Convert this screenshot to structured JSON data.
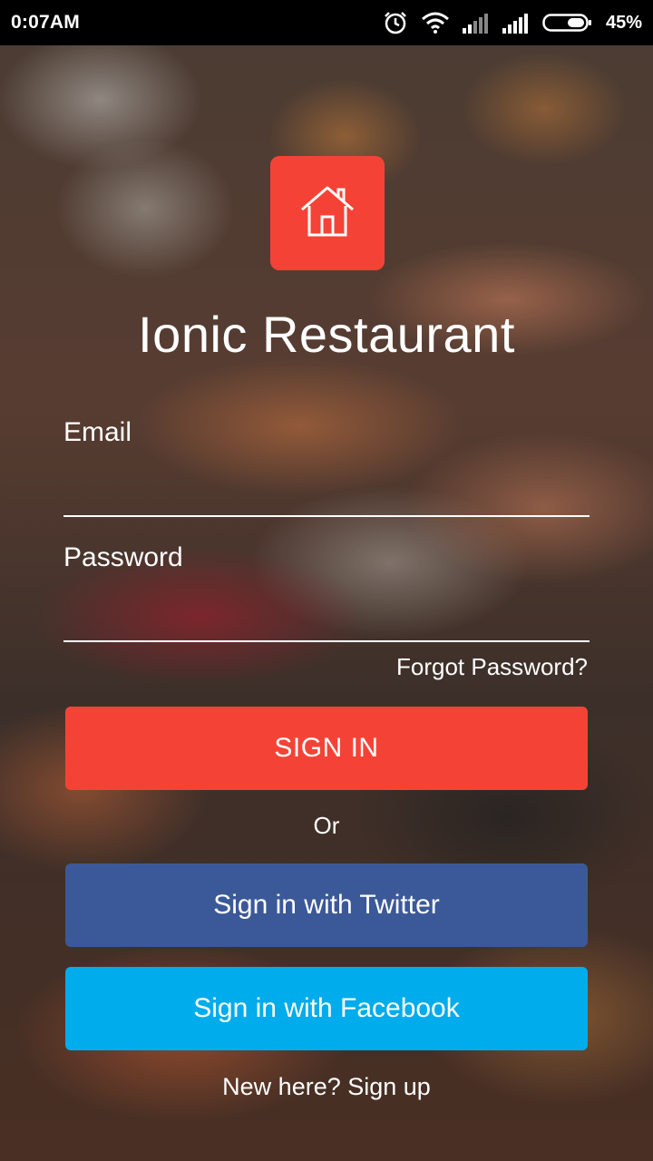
{
  "status_bar": {
    "time": "0:07AM",
    "battery_percent": "45%",
    "icons": [
      "alarm-icon",
      "wifi-icon",
      "signal-icon",
      "signal-icon",
      "battery-icon"
    ]
  },
  "app": {
    "title": "Ionic Restaurant",
    "logo_icon": "home-icon",
    "accent_color": "#f44336"
  },
  "login_form": {
    "email_label": "Email",
    "email_value": "",
    "password_label": "Password",
    "password_value": "",
    "forgot_password": "Forgot Password?",
    "sign_in_label": "SIGN IN",
    "or_label": "Or",
    "twitter_label": "Sign in with Twitter",
    "twitter_color": "#3b5998",
    "facebook_label": "Sign in with Facebook",
    "facebook_color": "#00acec",
    "signup_label": "New here? Sign up"
  }
}
